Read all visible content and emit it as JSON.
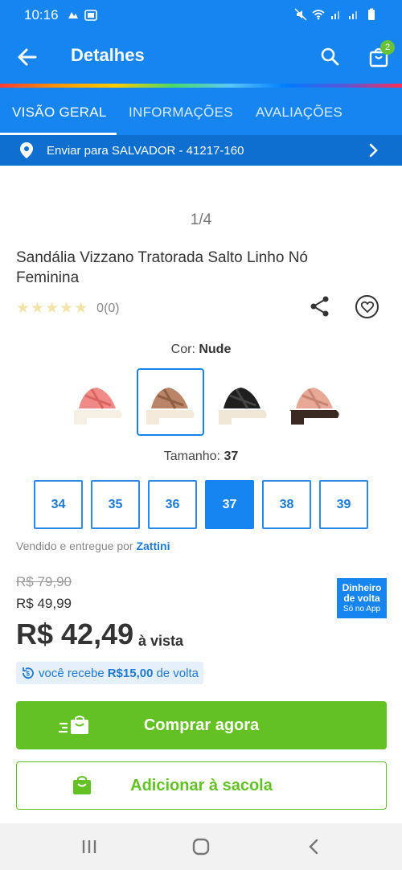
{
  "statusbar": {
    "time": "10:16"
  },
  "header": {
    "title": "Detalhes",
    "cart_count": "2"
  },
  "tabs": [
    {
      "label": "VISÃO GERAL",
      "active": true
    },
    {
      "label": "INFORMAÇÕES",
      "active": false
    },
    {
      "label": "AVALIAÇÕES",
      "active": false
    }
  ],
  "shipping": {
    "text": "Enviar para SALVADOR - 41217-160"
  },
  "gallery": {
    "counter": "1/4"
  },
  "product": {
    "name": "Sandália Vizzano Tratorada Salto Linho Nó Feminina",
    "stars": "★★★★★",
    "rating_count": "0(0)",
    "color_prefix": "Cor:",
    "color_value": "Nude",
    "size_prefix": "Tamanho:",
    "size_value": "37",
    "sizes": [
      "34",
      "35",
      "36",
      "37",
      "38",
      "39"
    ],
    "selected_size": "37",
    "seller_prefix": "Vendido e entregue por",
    "seller_name": "Zattini"
  },
  "pricing": {
    "old_price": "R$ 79,90",
    "list_price": "R$ 49,99",
    "price": "R$ 42,49",
    "price_suffix": "à vista",
    "promo_line1": "Dinheiro",
    "promo_line2": "de volta",
    "promo_line3": "Só no App",
    "cashback_prefix": "você recebe",
    "cashback_value": "R$15,00",
    "cashback_suffix": "de volta"
  },
  "actions": {
    "buy_label": "Comprar agora",
    "add_label": "Adicionar à sacola"
  },
  "colors": {
    "primary": "#1685f0",
    "green": "#63c124"
  },
  "swatches": [
    {
      "name": "pink",
      "strap": "#f08a86",
      "sole": "#f6efe4"
    },
    {
      "name": "nude",
      "strap": "#b98467",
      "sole": "#f4eadb"
    },
    {
      "name": "black",
      "strap": "#1f1f1f",
      "sole": "#efe6d6"
    },
    {
      "name": "rose",
      "strap": "#e6a996",
      "sole": "#3a2a22"
    }
  ]
}
